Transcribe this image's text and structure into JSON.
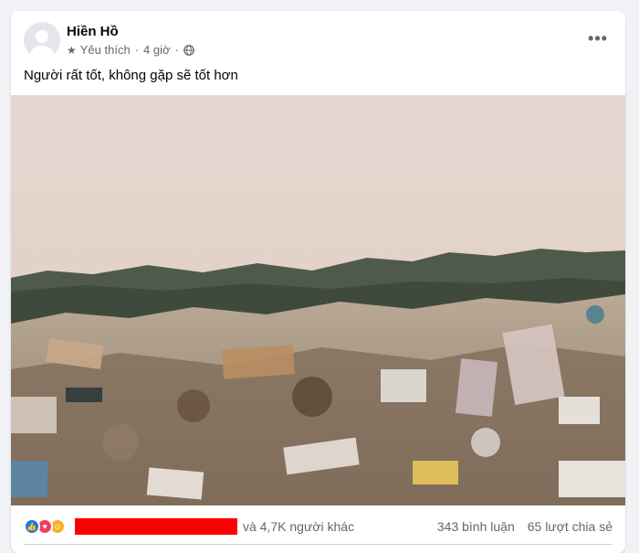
{
  "post": {
    "author": "Hiền Hồ",
    "badge_icon": "star-icon",
    "badge_label": "Yêu thích",
    "separator": "·",
    "time": "4 giờ",
    "audience_icon": "globe-icon",
    "more_icon": "more-options-icon",
    "more_label": "•••",
    "text": "Người rất tốt, không gặp sẽ tốt hơn"
  },
  "photo": {
    "subject": "landfill-garbage-photo"
  },
  "footer": {
    "reactions": [
      "like",
      "love",
      "care"
    ],
    "others_text": "và 4,7K người khác",
    "comments_text": "343 bình luận",
    "shares_text": "65 lượt chia sẻ"
  },
  "colors": {
    "like": "#1877f2",
    "love": "#f33e58",
    "care": "#f7b125",
    "redaction": "#ff0000",
    "secondary_text": "#65676b"
  }
}
